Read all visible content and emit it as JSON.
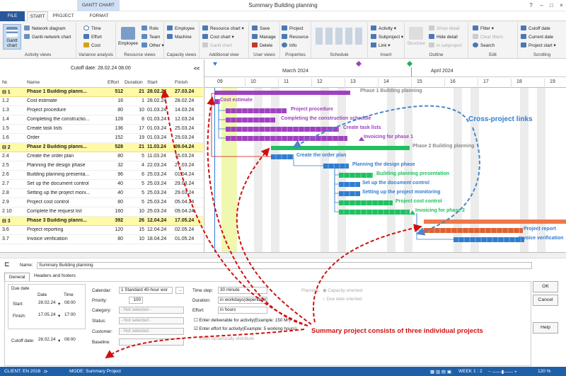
{
  "window": {
    "title": "Summary Building planning",
    "context_tab": "GANTT CHART"
  },
  "tabs": [
    "FILE",
    "START",
    "PROJECT",
    "FORMAT"
  ],
  "ribbon": {
    "groups": [
      "Activity views",
      "Variance analysis",
      "Resource views",
      "Capacity views",
      "Additional view",
      "User views",
      "Properties",
      "Schedule",
      "Insert",
      "Outline",
      "Edit",
      "Scrolling"
    ],
    "activity_views": {
      "gantt": "Gantt chart",
      "network": "Network diagram",
      "gantt_network": "Gantt-network chart"
    },
    "variance": {
      "time": "Time",
      "effort": "Effort",
      "cost": "Cost"
    },
    "resource": {
      "employee": "Employee",
      "role": "Role",
      "team": "Team",
      "other": "Other"
    },
    "capacity": {
      "employee": "Employee",
      "machine": "Machine"
    },
    "additional": {
      "resource_chart": "Resource chart",
      "cost_chart": "Cost chart",
      "gantt_chart": "Gantt chart"
    },
    "user_views": {
      "save": "Save",
      "manage": "Manage",
      "delete": "Delete"
    },
    "properties": {
      "project": "Project",
      "resource": "Resource",
      "info": "Info"
    },
    "insert": {
      "activity": "Activity",
      "subproject": "Subproject",
      "link": "Link"
    },
    "outline": {
      "structure": "Structure",
      "show_detail": "Show detail",
      "hide_detail": "Hide detail",
      "in_subproject": "in subproject"
    },
    "edit": {
      "filter": "Filter",
      "clear_filters": "Clear filters",
      "search": "Search"
    },
    "scrolling": {
      "cutoff": "Cutoff date",
      "current": "Current date",
      "project_start": "Project start"
    }
  },
  "table": {
    "cutoff": "Cutoff date: 28.02.24 08.00",
    "collapse": "<<",
    "headers": {
      "nr": "Nr.",
      "name": "Name",
      "effort": "Effort",
      "duration": "Duration",
      "start": "Start",
      "finish": "Finish"
    },
    "rows": [
      {
        "nr": "⊟ 1",
        "name": "Phase 1 Building planni...",
        "effort": "512",
        "dur": "21",
        "start": "28.02.24",
        "finish": "27.03.24",
        "sum": true
      },
      {
        "nr": "1.2",
        "name": "Cost estimate",
        "effort": "16",
        "dur": "1",
        "start": "28.02.24",
        "finish": "28.02.24"
      },
      {
        "nr": "1.3",
        "name": "Project procedure",
        "effort": "80",
        "dur": "10",
        "start": "01.03.24",
        "finish": "14.03.24"
      },
      {
        "nr": "1.4",
        "name": "Completing the constructio...",
        "effort": "128",
        "dur": "8",
        "start": "01.03.24",
        "finish": "12.03.24"
      },
      {
        "nr": "1.5",
        "name": "Create task lists",
        "effort": "136",
        "dur": "17",
        "start": "01.03.24",
        "finish": "25.03.24"
      },
      {
        "nr": "1.6",
        "name": "Order",
        "effort": "152",
        "dur": "19",
        "start": "01.03.24",
        "finish": "29.03.24"
      },
      {
        "nr": "⊟ 2",
        "name": "Phase 2 Building planni...",
        "effort": "528",
        "dur": "21",
        "start": "11.03.24",
        "finish": "09.04.24",
        "sum": true
      },
      {
        "nr": "2.4",
        "name": "Create the order plan",
        "effort": "80",
        "dur": "5",
        "start": "11.03.24",
        "finish": "15.03.24"
      },
      {
        "nr": "2.5",
        "name": "Planning the design phase",
        "effort": "32",
        "dur": "4",
        "start": "22.03.24",
        "finish": "27.03.24"
      },
      {
        "nr": "2.6",
        "name": "Building planning presenta...",
        "effort": "96",
        "dur": "6",
        "start": "25.03.24",
        "finish": "01.04.24"
      },
      {
        "nr": "2.7",
        "name": "Set up the document control",
        "effort": "40",
        "dur": "5",
        "start": "25.03.24",
        "finish": "29.03.24"
      },
      {
        "nr": "2.8",
        "name": "Setting up the project moni...",
        "effort": "40",
        "dur": "5",
        "start": "25.03.24",
        "finish": "29.03.24"
      },
      {
        "nr": "2.9",
        "name": "Project cost control",
        "effort": "80",
        "dur": "5",
        "start": "25.03.24",
        "finish": "05.04.24"
      },
      {
        "nr": "2 10",
        "name": "Complete the request list",
        "effort": "160",
        "dur": "10",
        "start": "25.03.24",
        "finish": "09.04.24"
      },
      {
        "nr": "⊟ 3",
        "name": "Phase 3 Building planni...",
        "effort": "392",
        "dur": "26",
        "start": "12.04.24",
        "finish": "17.05.24",
        "sum": true
      },
      {
        "nr": "3.6",
        "name": "Project reporting",
        "effort": "120",
        "dur": "15",
        "start": "12.04.24",
        "finish": "02.05.24"
      },
      {
        "nr": "3.7",
        "name": "Invoice verification",
        "effort": "80",
        "dur": "10",
        "start": "18.04.24",
        "finish": "01.05.24"
      }
    ]
  },
  "gantt": {
    "months": [
      "March 2024",
      "April 2024"
    ],
    "days": [
      "09",
      "10",
      "11",
      "12",
      "13",
      "14",
      "15",
      "16",
      "17",
      "18",
      "19"
    ],
    "labels": {
      "phase1": "Phase 1 Building planning",
      "cost": "Cost estimate",
      "procedure": "Project procedure",
      "constr": "Completing the construction schedule",
      "tasks": "Create task lists",
      "invoice1": "Invoicing for phase 1",
      "phase2": "Phase 2 Building planning",
      "order": "Create the order plan",
      "design": "Planning the design phase",
      "present": "Building planning presentation",
      "doc": "Set up the document control",
      "monitor": "Setting up the project monitoring",
      "costctl": "Project cost control",
      "invoice2": "Invoicing for phase 2",
      "report": "Project report",
      "invver": "Invoice verification"
    },
    "callout_links": "Cross-project links",
    "callout_summary": "Summary project consists of three individual projects"
  },
  "editor": {
    "name_label": "Name:",
    "name_value": "Summary Building planning",
    "tabs": [
      "General",
      "Headers and footers"
    ],
    "due_date": "Due date",
    "date": "Date",
    "time": "Time",
    "start": "Start:",
    "start_date": "28.02.24",
    "start_time": "08:00",
    "finish": "Finish:",
    "finish_date": "17.05.24",
    "finish_time": "17:00",
    "cutoff": "Cutoff date:",
    "cutoff_date": "28.02.24",
    "cutoff_time": "08:00",
    "calendar": "Calendar:",
    "calendar_value": "1 Standard 40-hour wor",
    "priority": "Priority:",
    "priority_value": "100",
    "category": "Category:",
    "status": "Status:",
    "customer": "Customer:",
    "baseline": "Baseline:",
    "not_selected": "- Not selected -",
    "timestep": "Time step:",
    "timestep_value": "30 minute",
    "duration": "Duration:",
    "duration_value": "in workdays(dependent on project)",
    "effort": "Effort:",
    "effort_value": "in hours",
    "chk_deliverable": "Enter deliverable for activity(Example: 150 M²)",
    "chk_effort": "Enter effort for activity(Example: 5 working hours)",
    "effort_dyn": "Effort dynamically distribute",
    "planning": "Planning:",
    "capacity": "Capacity oriented",
    "due_oriented": "Due date oriented",
    "ok": "OK",
    "cancel": "Cancel",
    "help": "Help"
  },
  "status": {
    "client": "CLIENT: EN 2016",
    "mode": "MODE: Summary Project",
    "week": "WEEK 1 : 2",
    "zoom": "120 %"
  }
}
